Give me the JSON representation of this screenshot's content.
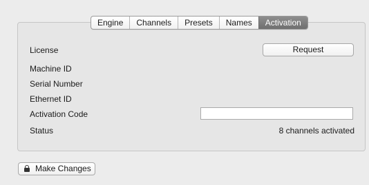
{
  "tabs": [
    {
      "label": "Engine",
      "active": false
    },
    {
      "label": "Channels",
      "active": false
    },
    {
      "label": "Presets",
      "active": false
    },
    {
      "label": "Names",
      "active": false
    },
    {
      "label": "Activation",
      "active": true
    }
  ],
  "form": {
    "license_label": "License",
    "request_button": "Request",
    "machine_id_label": "Machine ID",
    "serial_number_label": "Serial Number",
    "ethernet_id_label": "Ethernet ID",
    "activation_code_label": "Activation Code",
    "activation_code_value": "",
    "status_label": "Status",
    "status_value": "8 channels activated"
  },
  "footer": {
    "make_changes_label": "Make Changes",
    "icon": "lock-icon"
  }
}
